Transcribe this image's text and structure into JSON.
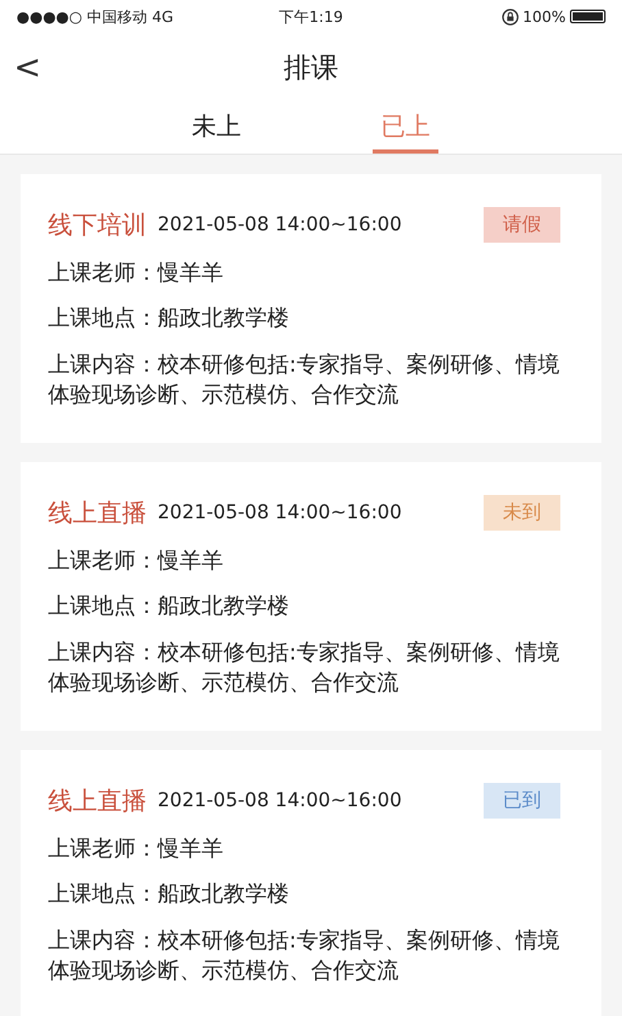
{
  "status_bar": {
    "carrier": "●●●●○ 中国移动 4G",
    "time": "下午1:19",
    "battery": "100%"
  },
  "nav": {
    "back": "<",
    "title": "排课"
  },
  "tabs": [
    {
      "label": "未上",
      "selected": false
    },
    {
      "label": "已上",
      "selected": true
    }
  ],
  "courses": [
    {
      "type": "线下培训",
      "time": "2021-05-08 14:00~16:00",
      "badge": {
        "label": "请假",
        "kind": "leave"
      },
      "teacher": "上课老师：慢羊羊",
      "location": "上课地点：船政北教学楼",
      "content": "上课内容：校本研修包括:专家指导、案例研修、情境体验现场诊断、示范模仿、合作交流"
    },
    {
      "type": "线上直播",
      "time": "2021-05-08 14:00~16:00",
      "badge": {
        "label": "未到",
        "kind": "absent"
      },
      "teacher": "上课老师：慢羊羊",
      "location": "上课地点：船政北教学楼",
      "content": "上课内容：校本研修包括:专家指导、案例研修、情境体验现场诊断、示范模仿、合作交流"
    },
    {
      "type": "线上直播",
      "time": "2021-05-08 14:00~16:00",
      "badge": {
        "label": "已到",
        "kind": "present"
      },
      "teacher": "上课老师：慢羊羊",
      "location": "上课地点：船政北教学楼",
      "content": "上课内容：校本研修包括:专家指导、案例研修、情境体验现场诊断、示范模仿、合作交流"
    }
  ]
}
